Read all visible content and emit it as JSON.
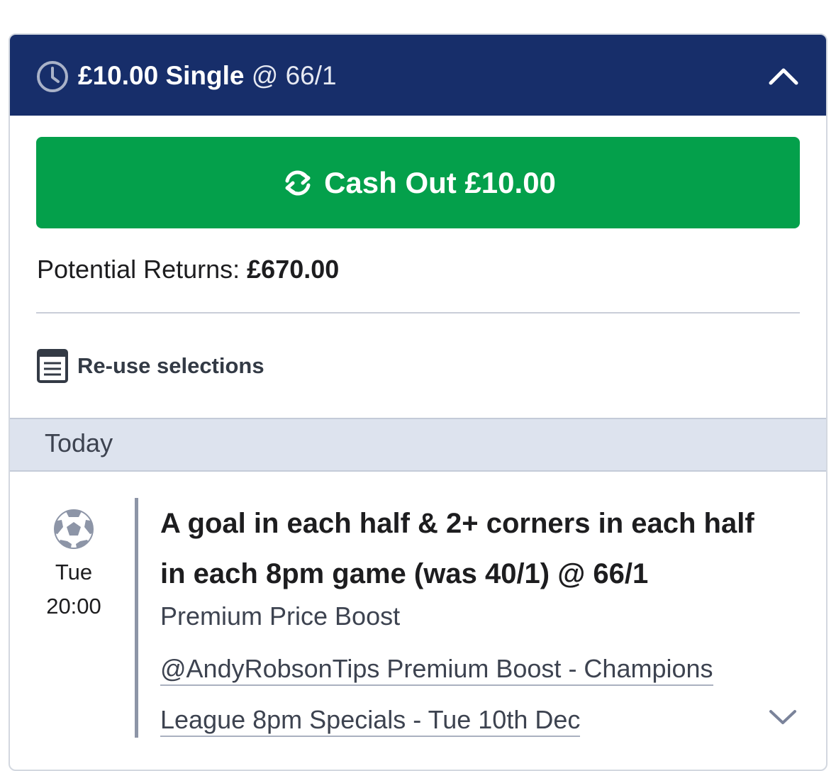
{
  "header": {
    "stake": "£10.00 Single",
    "odds_text": "@ 66/1",
    "clock_icon": "clock-icon",
    "toggle_icon": "chevron-up-icon"
  },
  "cashout": {
    "label": "Cash Out £10.00",
    "icon": "refresh-icon",
    "color": "#04a04b"
  },
  "returns": {
    "label": "Potential Returns: ",
    "amount": "£670.00"
  },
  "reuse": {
    "label": "Re-use selections",
    "icon": "document-icon"
  },
  "section": {
    "label": "Today"
  },
  "selection": {
    "sport_icon": "football-icon",
    "day": "Tue",
    "time": "20:00",
    "title": "A goal in each half & 2+ corners in each half in each 8pm game (was 40/1) @ 66/1",
    "market": "Premium Price Boost",
    "event_line1": "@AndyRobsonTips Premium Boost - Champions",
    "event_line2": "League 8pm Specials - Tue 10th Dec",
    "expand_icon": "chevron-down-icon"
  },
  "colors": {
    "header_bg": "#172e6a",
    "section_bg": "#dde3ee"
  }
}
